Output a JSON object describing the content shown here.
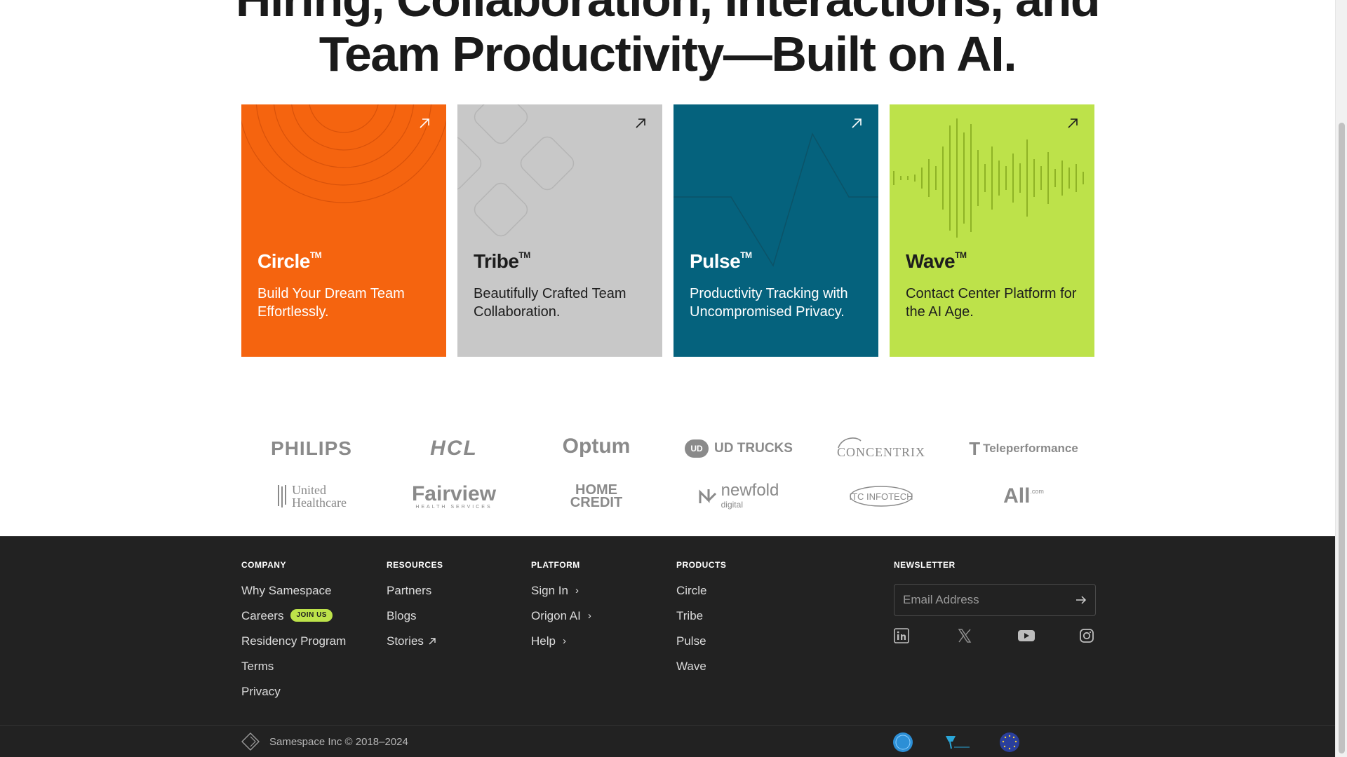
{
  "hero": {
    "line1": "Hiring, Collaboration, Interactions, and",
    "line2": "Team Productivity—Built on AI."
  },
  "products": [
    {
      "name": "Circle",
      "tm": "TM",
      "desc": "Build Your Dream Team Effortlessly.",
      "color": "#f5640f"
    },
    {
      "name": "Tribe",
      "tm": "TM",
      "desc": "Beautifully Crafted Team Collaboration.",
      "color": "#c8c8c8"
    },
    {
      "name": "Pulse",
      "tm": "TM",
      "desc": "Productivity Tracking with Uncompromised Privacy.",
      "color": "#05627d"
    },
    {
      "name": "Wave",
      "tm": "TM",
      "desc": "Contact Center Platform for the AI Age.",
      "color": "#bde24a"
    }
  ],
  "logos": {
    "philips": "PHILIPS",
    "hcl": "HCL",
    "optum": "Optum",
    "udtrucks": "UD TRUCKS",
    "udmark": "UD",
    "concentrix": "CONCENTRIX",
    "teleperformance": "Teleperformance",
    "uhc_line1": "United",
    "uhc_line2": "Healthcare",
    "fairview": "Fairview",
    "fairview_sub": "HEALTH SERVICES",
    "homecredit_line1": "HOME",
    "homecredit_line2": "CREDIT",
    "newfold": "newfold",
    "newfold_sub": "digital",
    "itc": "ITC INFOTECH",
    "all": "All",
    "all_sup": ".com"
  },
  "footer": {
    "company": {
      "heading": "COMPANY",
      "items": [
        "Why Samespace",
        "Careers",
        "Residency Program",
        "Terms",
        "Privacy"
      ],
      "careers_badge": "JOIN US"
    },
    "resources": {
      "heading": "RESOURCES",
      "items": [
        "Partners",
        "Blogs",
        "Stories"
      ]
    },
    "platform": {
      "heading": "PLATFORM",
      "items": [
        "Sign In",
        "Origon AI",
        "Help"
      ]
    },
    "products": {
      "heading": "PRODUCTS",
      "items": [
        "Circle",
        "Tribe",
        "Pulse",
        "Wave"
      ]
    },
    "newsletter": {
      "heading": "NEWSLETTER",
      "placeholder": "Email Address"
    },
    "socials": [
      "linkedin-icon",
      "x-icon",
      "youtube-icon",
      "instagram-icon"
    ],
    "copyright": "Samespace Inc © 2018–2024",
    "cert_badges": [
      "soc-badge",
      "hipaa-badge",
      "gdpr-badge"
    ]
  },
  "colors": {
    "footer_bg": "#222222",
    "accent_green": "#bde24a",
    "logo_gray": "#8a8a8a"
  }
}
